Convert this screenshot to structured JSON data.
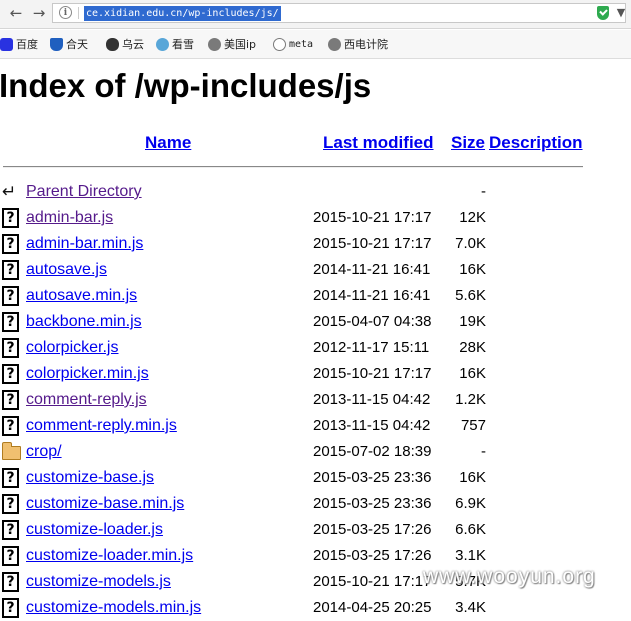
{
  "browser": {
    "back_icon": "back-arrow-icon",
    "forward_icon": "forward-arrow-icon",
    "url": "ce.xidian.edu.cn/wp-includes/js/",
    "security_icon": "shield-check-icon",
    "accent": "#2eaa4f"
  },
  "bookmarks": [
    {
      "label": "百度",
      "icon": "paw-icon",
      "color": "#2932e1"
    },
    {
      "label": "合天",
      "icon": "shield-icon",
      "color": "#1f5fbf"
    },
    {
      "label": "乌云",
      "icon": "cloud-icon",
      "color": "#333333"
    },
    {
      "label": "看雪",
      "icon": "snowflake-icon",
      "color": "#58a6d8"
    },
    {
      "label": "美国ip",
      "icon": "globe-icon",
      "color": "#7a7a7a"
    },
    {
      "label": "meta",
      "icon": "robot-icon",
      "color": "#7a7a7a"
    },
    {
      "label": "西电计院",
      "icon": "globe-icon",
      "color": "#7a7a7a"
    }
  ],
  "page": {
    "title": "Index of /wp-includes/js",
    "columns": {
      "name": "Name",
      "last_modified": "Last modified",
      "size": "Size",
      "description": "Description"
    },
    "rows": [
      {
        "type": "parent",
        "name": "Parent Directory",
        "date": "",
        "size": "-",
        "visited": true
      },
      {
        "type": "file",
        "name": "admin-bar.js",
        "date": "2015-10-21 17:17",
        "size": "12K",
        "visited": true
      },
      {
        "type": "file",
        "name": "admin-bar.min.js",
        "date": "2015-10-21 17:17",
        "size": "7.0K",
        "visited": false
      },
      {
        "type": "file",
        "name": "autosave.js",
        "date": "2014-11-21 16:41",
        "size": "16K",
        "visited": false
      },
      {
        "type": "file",
        "name": "autosave.min.js",
        "date": "2014-11-21 16:41",
        "size": "5.6K",
        "visited": false
      },
      {
        "type": "file",
        "name": "backbone.min.js",
        "date": "2015-04-07 04:38",
        "size": "19K",
        "visited": false
      },
      {
        "type": "file",
        "name": "colorpicker.js",
        "date": "2012-11-17 15:11",
        "size": "28K",
        "visited": false
      },
      {
        "type": "file",
        "name": "colorpicker.min.js",
        "date": "2015-10-21 17:17",
        "size": "16K",
        "visited": false
      },
      {
        "type": "file",
        "name": "comment-reply.js",
        "date": "2013-11-15 04:42",
        "size": "1.2K",
        "visited": true
      },
      {
        "type": "file",
        "name": "comment-reply.min.js",
        "date": "2013-11-15 04:42",
        "size": "757",
        "visited": false
      },
      {
        "type": "folder",
        "name": "crop/",
        "date": "2015-07-02 18:39",
        "size": "-",
        "visited": false
      },
      {
        "type": "file",
        "name": "customize-base.js",
        "date": "2015-03-25 23:36",
        "size": "16K",
        "visited": false
      },
      {
        "type": "file",
        "name": "customize-base.min.js",
        "date": "2015-03-25 23:36",
        "size": "6.9K",
        "visited": false
      },
      {
        "type": "file",
        "name": "customize-loader.js",
        "date": "2015-03-25 17:26",
        "size": "6.6K",
        "visited": false
      },
      {
        "type": "file",
        "name": "customize-loader.min.js",
        "date": "2015-03-25 17:26",
        "size": "3.1K",
        "visited": false
      },
      {
        "type": "file",
        "name": "customize-models.js",
        "date": "2015-10-21 17:17",
        "size": "5.7K",
        "visited": false
      },
      {
        "type": "file",
        "name": "customize-models.min.js",
        "date": "2014-04-25 20:25",
        "size": "3.4K",
        "visited": false
      }
    ]
  },
  "watermark": "www.wooyun.org"
}
